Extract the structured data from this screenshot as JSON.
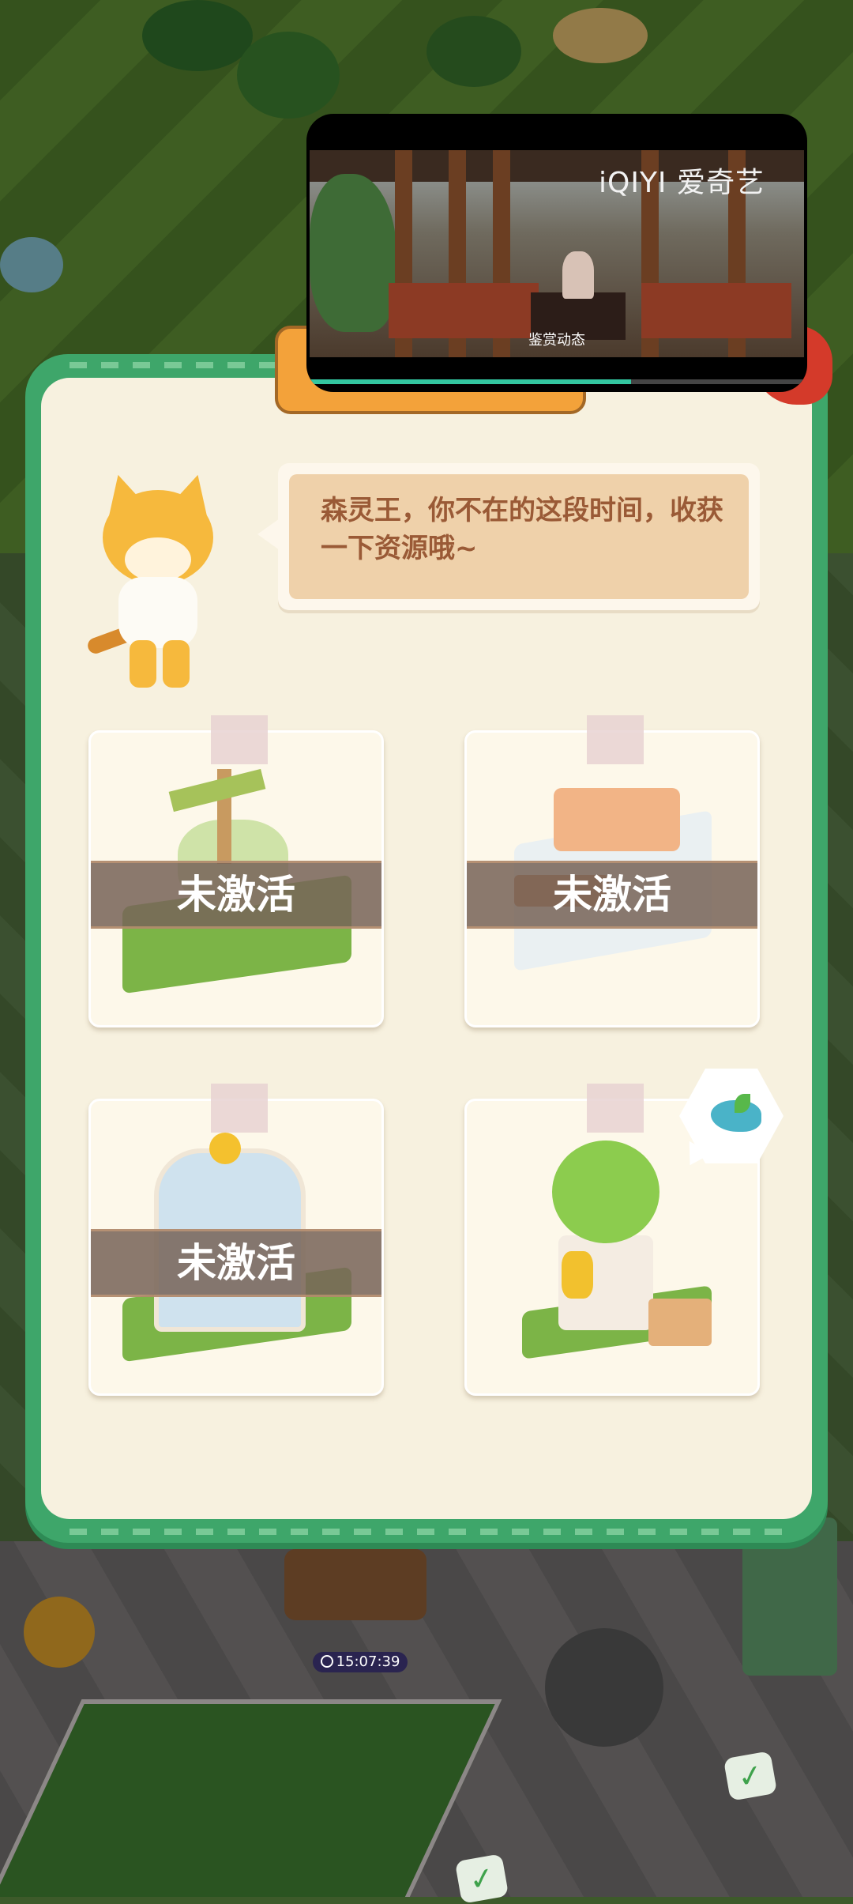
{
  "video": {
    "brand": "iQIYI 爱奇艺",
    "subtitle": "鉴赏动态",
    "progress": 0.65
  },
  "dialog": {
    "message": "森灵王，你不在的这段时间，收获一下资源哦~"
  },
  "buildings": [
    {
      "name": "campsite",
      "status_label": "未激活",
      "active": false
    },
    {
      "name": "shop",
      "status_label": "未激活",
      "active": false
    },
    {
      "name": "greenhouse",
      "status_label": "未激活",
      "active": false
    },
    {
      "name": "slime-statue",
      "status_label": "",
      "active": true,
      "reward_icon": "leaf-resource-icon"
    }
  ],
  "hud": {
    "timer": "15:07:39"
  },
  "colors": {
    "dialog_border": "#3ea66a",
    "dialog_bg": "#f7f1df",
    "speech_text": "#9a5a36",
    "inactive_band": "#786458"
  }
}
